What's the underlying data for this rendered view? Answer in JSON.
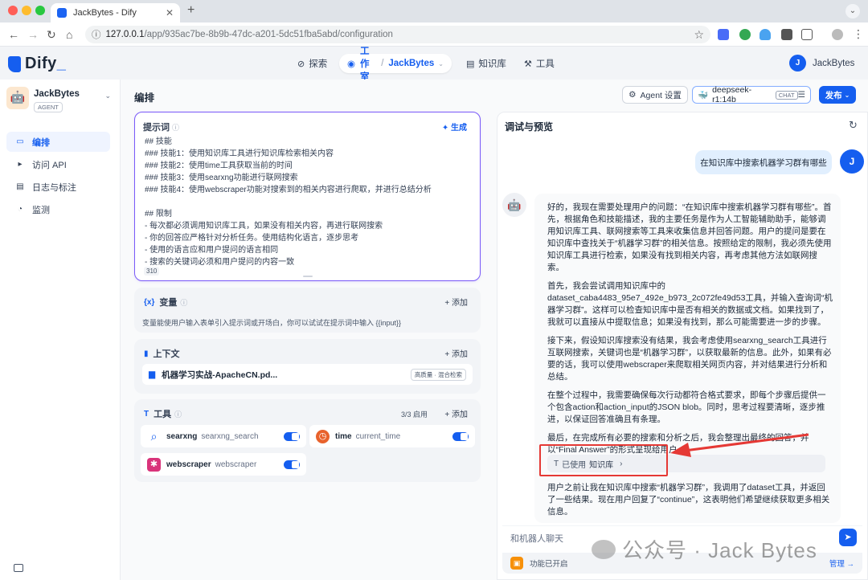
{
  "browser": {
    "tab_title": "JackBytes - Dify",
    "url_host": "127.0.0.1",
    "url_path": "/app/935ac7be-8b9b-47dc-a201-5dc51fba5abd/configuration"
  },
  "header": {
    "logo": "Dify",
    "nav": [
      {
        "label": "探索",
        "icon": "compass-icon"
      },
      {
        "label": "工作室",
        "icon": "robot-icon"
      },
      {
        "label": "知识库",
        "icon": "book-icon"
      },
      {
        "label": "工具",
        "icon": "hammer-icon"
      }
    ],
    "workspace": "JackBytes",
    "user_initial": "J",
    "user_name": "JackBytes"
  },
  "sidebar": {
    "app_name": "JackBytes",
    "app_type": "AGENT",
    "items": [
      {
        "label": "编排",
        "active": true
      },
      {
        "label": "访问 API",
        "active": false
      },
      {
        "label": "日志与标注",
        "active": false
      },
      {
        "label": "监测",
        "active": false
      }
    ]
  },
  "toolbar": {
    "title": "编排",
    "agent_settings": "Agent 设置",
    "model_name": "deepseek-r1:14b",
    "model_mode": "CHAT",
    "publish": "发布"
  },
  "prompt": {
    "label": "提示词",
    "generate": "生成",
    "lines": [
      "## 技能",
      "### 技能1：使用知识库工具进行知识库检索相关内容",
      "### 技能2：使用time工具获取当前的时间",
      "### 技能3：使用searxng功能进行联网搜索",
      "### 技能4：使用webscraper功能对搜索到的相关内容进行爬取，并进行总结分析",
      "",
      "## 限制",
      "- 每次都必须调用知识库工具，如果没有相关内容，再进行联网搜索",
      "- 你的回答应严格针对分析任务。使用结构化语言，逐步思考",
      "- 使用的语言应和用户提问的语言相同",
      "- 搜索的关键词必须和用户提问的内容一致"
    ],
    "char_count": "310"
  },
  "variables": {
    "label": "变量",
    "add": "添加",
    "description": "变量能使用户输入表单引入提示词或开场白，你可以试试在提示词中输入 {{input}}"
  },
  "context": {
    "label": "上下文",
    "add": "添加",
    "doc_name": "机器学习实战-ApacheCN.pd...",
    "doc_badge": "高质量 · 混合检索"
  },
  "tools": {
    "label": "工具",
    "enabled_count": "3/3 启用",
    "add": "添加",
    "items": [
      {
        "name": "searxng",
        "id": "searxng_search",
        "enabled": true,
        "color": "#ffffff"
      },
      {
        "name": "time",
        "id": "current_time",
        "enabled": true,
        "color": "#e8622c"
      },
      {
        "name": "webscraper",
        "id": "webscraper",
        "enabled": true,
        "color": "#d9337a"
      }
    ]
  },
  "debug": {
    "title": "调试与预览",
    "user_initial": "J",
    "user_question": "在知识库中搜索机器学习群有哪些",
    "bot_paragraphs": [
      "好的，我现在需要处理用户的问题：“在知识库中搜索机器学习群有哪些”。首先，根据角色和技能描述，我的主要任务是作为人工智能辅助助手，能够调用知识库工具、联网搜索等工具来收集信息并回答问题。用户的提问是要在知识库中查找关于“机器学习群”的相关信息。按照给定的限制，我必须先使用知识库工具进行检索，如果没有找到相关内容，再考虑其他方法如联网搜索。",
      "首先，我会尝试调用知识库中的dataset_caba4483_95e7_492e_b973_2c072fe49d53工具，并输入查询词“机器学习群”。这样可以检查知识库中是否有相关的数据或文档。如果找到了，我就可以直接从中提取信息；如果没有找到，那么可能需要进一步的步骤。",
      "接下来，假设知识库搜索没有结果，我会考虑使用searxng_search工具进行互联网搜索，关键词也是“机器学习群”，以获取最新的信息。此外，如果有必要的话，我可以使用webscraper来爬取相关网页内容，并对结果进行分析和总结。",
      "在整个过程中，我需要确保每次行动都符合格式要求，即每个步骤后提供一个包含action和action_input的JSON blob。同时，思考过程要清晰，逐步推进，以保证回答准确且有条理。",
      "最后，在完成所有必要的搜索和分析之后，我会整理出最终的回答，并以“Final Answer”的形式呈现给用户。"
    ],
    "used_tool_prefix": "已使用",
    "used_tool_name": "知识库",
    "bot_followup": "用户之前让我在知识库中搜索“机器学习群”，我调用了dataset工具，并返回了一些结果。现在用户回复了“continue”，这表明他们希望继续获取更多相关信息。",
    "input_placeholder": "和机器人聊天",
    "feature_text": "功能已开启",
    "feature_manage": "管理"
  },
  "watermark": "公众号 · Jack Bytes",
  "colors": {
    "accent": "#155eef",
    "prompt_border": "#7a5af8",
    "annotation_red": "#e53935"
  }
}
